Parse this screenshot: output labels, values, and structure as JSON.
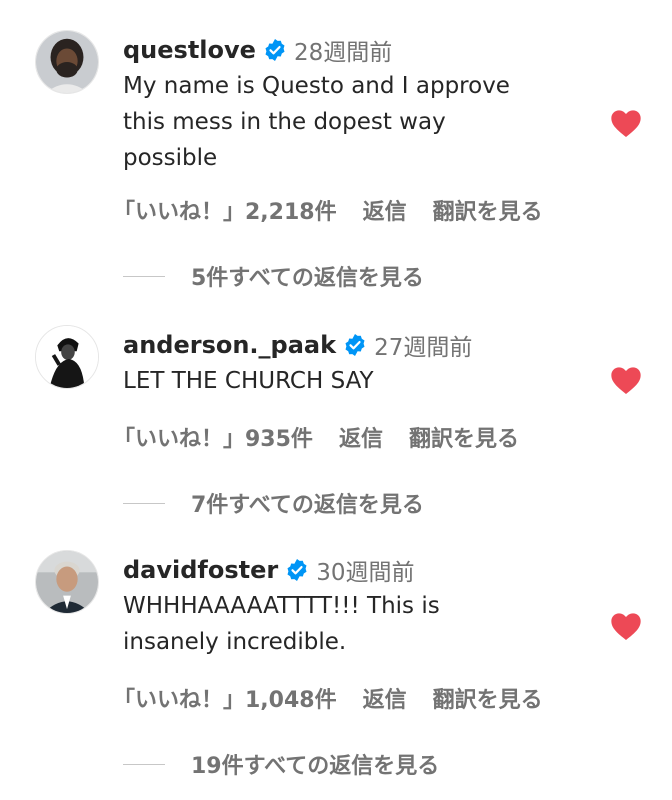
{
  "accent_heart": "#ed4956",
  "verified_color": "#0095f6",
  "comments": [
    {
      "username": "questlove",
      "time": "28週間前",
      "lines": [
        "My name is Questo and I approve",
        "this mess in the dopest way",
        "possible"
      ],
      "likes": "「いいね！」2,218件",
      "reply": "返信",
      "translate": "翻訳を見る",
      "view_replies": "5件すべての返信を見る"
    },
    {
      "username": "anderson._paak",
      "time": "27週間前",
      "lines": [
        "LET THE CHURCH SAY"
      ],
      "likes": "「いいね！」935件",
      "reply": "返信",
      "translate": "翻訳を見る",
      "view_replies": "7件すべての返信を見る"
    },
    {
      "username": "davidfoster",
      "time": "30週間前",
      "lines": [
        "WHHHAAAAATTTT!!! This is",
        "insanely incredible."
      ],
      "likes": "「いいね！」1,048件",
      "reply": "返信",
      "translate": "翻訳を見る",
      "view_replies": "19件すべての返信を見る"
    }
  ]
}
